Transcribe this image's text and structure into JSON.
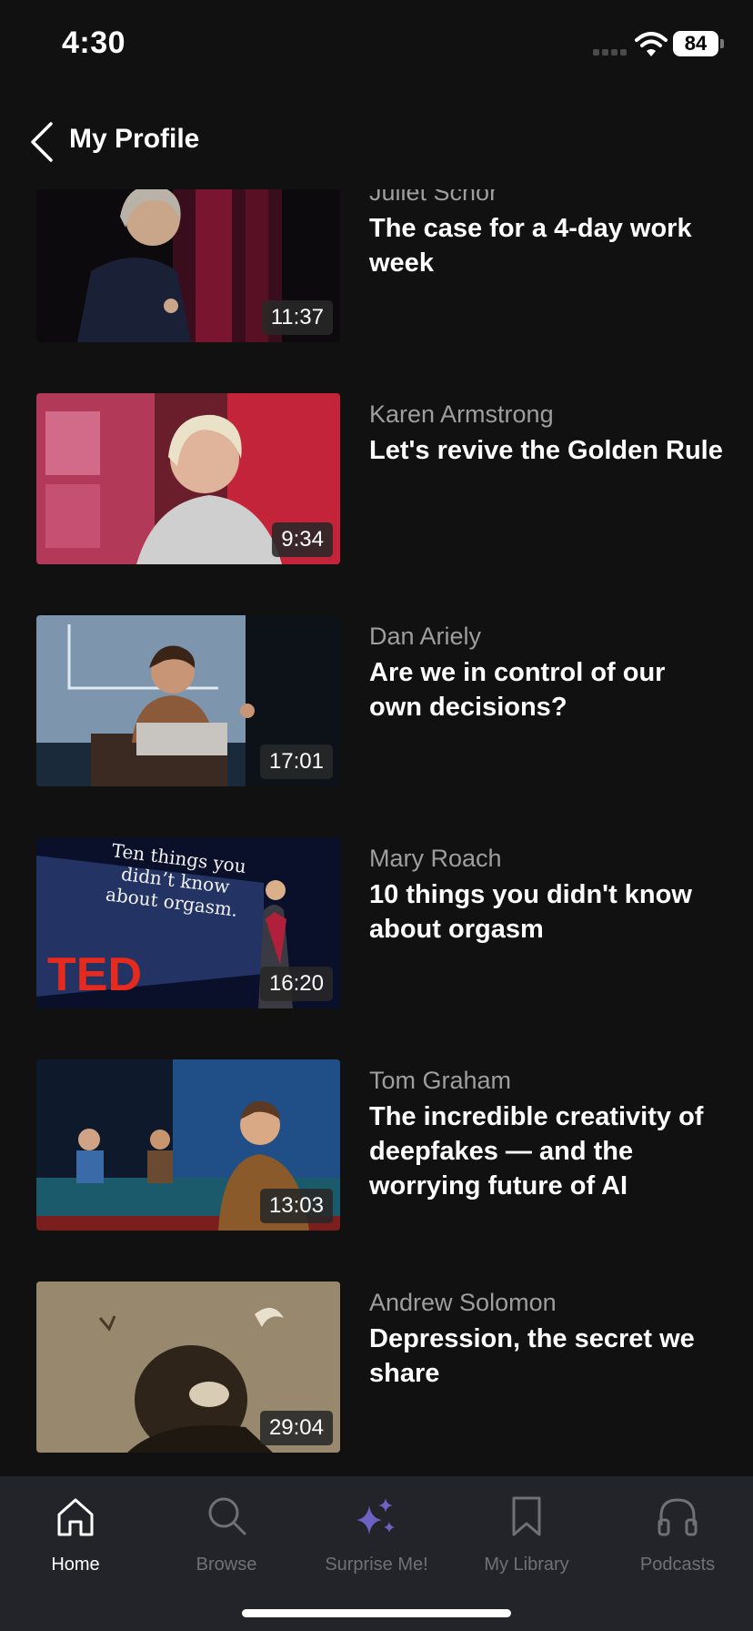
{
  "status": {
    "time": "4:30",
    "battery": "84"
  },
  "header": {
    "title": "My Profile"
  },
  "talks": [
    {
      "speaker": "Juliet Schor",
      "title": "The case for a 4-day work week",
      "duration": "11:37"
    },
    {
      "speaker": "Karen Armstrong",
      "title": "Let's revive the Golden Rule",
      "duration": "9:34"
    },
    {
      "speaker": "Dan Ariely",
      "title": "Are we in control of our own decisions?",
      "duration": "17:01"
    },
    {
      "speaker": "Mary Roach",
      "title": "10 things you didn't know about orgasm",
      "duration": "16:20"
    },
    {
      "speaker": "Tom Graham",
      "title": "The incredible creativity of deepfakes — and the worrying future of AI",
      "duration": "13:03"
    },
    {
      "speaker": "Andrew Solomon",
      "title": "Depression, the secret we share",
      "duration": "29:04"
    }
  ],
  "thumb_text": {
    "slide": [
      "Ten things you",
      "didn’t know",
      "about orgasm."
    ],
    "logo": "TED"
  },
  "tabs": [
    {
      "label": "Home",
      "icon": "home-icon",
      "active": true
    },
    {
      "label": "Browse",
      "icon": "search-icon",
      "active": false
    },
    {
      "label": "Surprise Me!",
      "icon": "sparkles-icon",
      "active": false
    },
    {
      "label": "My Library",
      "icon": "bookmark-icon",
      "active": false
    },
    {
      "label": "Podcasts",
      "icon": "headphones-icon",
      "active": false
    }
  ],
  "colors": {
    "background": "#111111",
    "tab_bar": "#22242a",
    "accent": "#6c62c4",
    "ted_red": "#e62b1e"
  }
}
